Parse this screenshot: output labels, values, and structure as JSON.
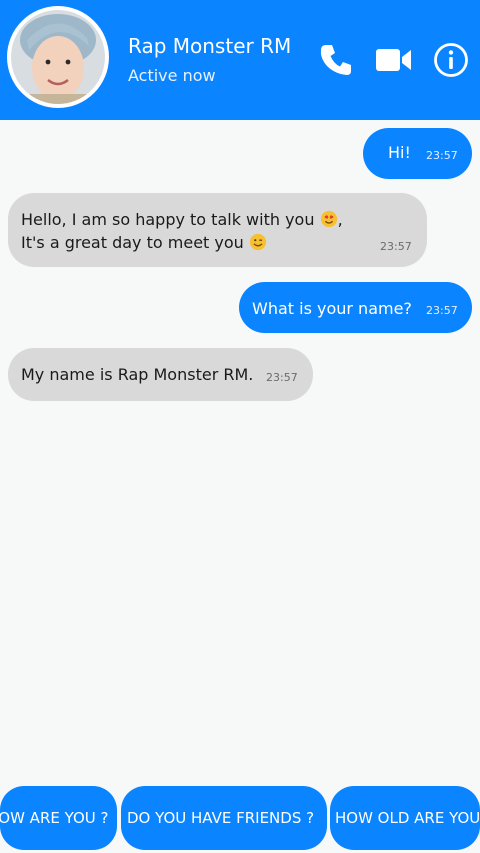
{
  "header": {
    "contact_name": "Rap Monster RM",
    "status": "Active now",
    "icons": [
      "phone-icon",
      "video-camera-icon",
      "info-icon"
    ]
  },
  "messages": [
    {
      "direction": "sent",
      "text": "Hi!",
      "time": "23:57"
    },
    {
      "direction": "received",
      "line1": "Hello, I am so happy to talk with you",
      "line1_suffix": ",",
      "line2": "It's a great day to meet you",
      "time": "23:57",
      "emojis": [
        "heart-eyes-emoji",
        "wink-emoji"
      ]
    },
    {
      "direction": "sent",
      "text": "What is your name?",
      "time": "23:57"
    },
    {
      "direction": "received",
      "text": "My name is Rap Monster RM.",
      "time": "23:57"
    }
  ],
  "quick_replies": [
    {
      "label": "HOW ARE YOU ?"
    },
    {
      "label": "DO YOU HAVE FRIENDS ?"
    },
    {
      "label": "HOW OLD ARE YOU"
    }
  ],
  "colors": {
    "accent": "#0a84ff",
    "received_bubble": "#d9d9d9",
    "background": "#f7f8f8"
  }
}
